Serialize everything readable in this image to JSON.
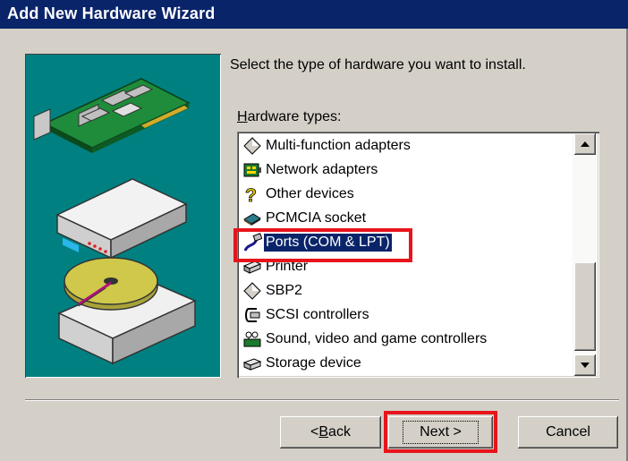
{
  "window": {
    "title": "Add New Hardware Wizard"
  },
  "instruction": "Select the type of hardware you want to install.",
  "hardware_types": {
    "label_prefix": "H",
    "label_rest": "ardware types:",
    "items": [
      {
        "label": "Multi-function adapters",
        "icon": "multifunction-adapter-icon",
        "selected": false
      },
      {
        "label": "Network adapters",
        "icon": "network-adapter-icon",
        "selected": false
      },
      {
        "label": "Other devices",
        "icon": "question-mark-icon",
        "selected": false
      },
      {
        "label": "PCMCIA socket",
        "icon": "pcmcia-socket-icon",
        "selected": false
      },
      {
        "label": "Ports (COM & LPT)",
        "icon": "port-cable-icon",
        "selected": true
      },
      {
        "label": "Printer",
        "icon": "printer-icon",
        "selected": false
      },
      {
        "label": "SBP2",
        "icon": "diamond-device-icon",
        "selected": false
      },
      {
        "label": "SCSI controllers",
        "icon": "scsi-controller-icon",
        "selected": false
      },
      {
        "label": "Sound, video and game controllers",
        "icon": "sound-video-game-icon",
        "selected": false
      },
      {
        "label": "Storage device",
        "icon": "storage-device-icon",
        "selected": false
      }
    ]
  },
  "buttons": {
    "back_prefix": "< ",
    "back_mnemonic": "B",
    "back_rest": "ack",
    "next": "Next >",
    "cancel": "Cancel"
  },
  "colors": {
    "title_bar": "#0a246a",
    "art_panel": "#008080",
    "selection": "#0a246a",
    "callout": "#e8141b",
    "face": "#d4d0c8"
  }
}
